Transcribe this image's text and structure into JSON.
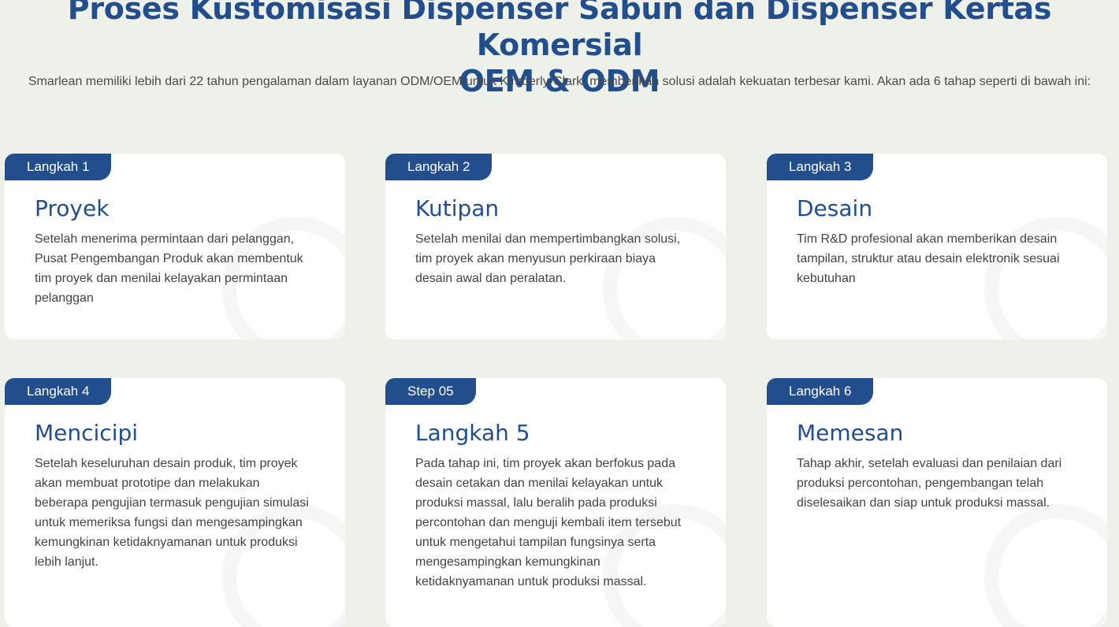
{
  "header": {
    "title_line1": "Proses Kustomisasi Dispenser Sabun dan Dispenser Kertas Komersial",
    "title_line2": "OEM & ODM",
    "subtitle": "Smarlean memiliki lebih dari 22 tahun pengalaman dalam layanan ODM/OEM untuk Kimberly-Clark, memberikan solusi adalah kekuatan terbesar kami. Akan ada 6 tahap seperti di bawah ini:"
  },
  "steps": [
    {
      "badge": "Langkah 1",
      "title": "Proyek",
      "description": "Setelah menerima permintaan dari pelanggan, Pusat Pengembangan Produk akan membentuk tim proyek dan menilai kelayakan permintaan pelanggan"
    },
    {
      "badge": "Langkah 2",
      "title": "Kutipan",
      "description": "Setelah menilai dan mempertimbangkan solusi, tim proyek akan menyusun perkiraan biaya desain awal dan peralatan."
    },
    {
      "badge": "Langkah 3",
      "title": "Desain",
      "description": "Tim R&D profesional akan memberikan desain tampilan, struktur atau desain elektronik sesuai kebutuhan"
    },
    {
      "badge": "Langkah 4",
      "title": "Mencicipi",
      "description": "Setelah keseluruhan desain produk, tim proyek akan membuat prototipe dan melakukan beberapa pengujian termasuk pengujian simulasi untuk memeriksa fungsi dan mengesampingkan kemungkinan ketidaknyamanan untuk produksi lebih lanjut."
    },
    {
      "badge": "Step 05",
      "title": "Langkah 5",
      "description": "Pada tahap ini, tim proyek akan berfokus pada desain cetakan dan menilai kelayakan untuk produksi massal, lalu beralih pada produksi percontohan dan menguji kembali item tersebut untuk mengetahui tampilan fungsinya serta mengesampingkan kemungkinan ketidaknyamanan untuk produksi massal."
    },
    {
      "badge": "Langkah 6",
      "title": "Memesan",
      "description": "Tahap akhir, setelah evaluasi dan penilaian dari produksi percontohan, pengembangan telah diselesaikan dan siap untuk produksi massal."
    }
  ]
}
